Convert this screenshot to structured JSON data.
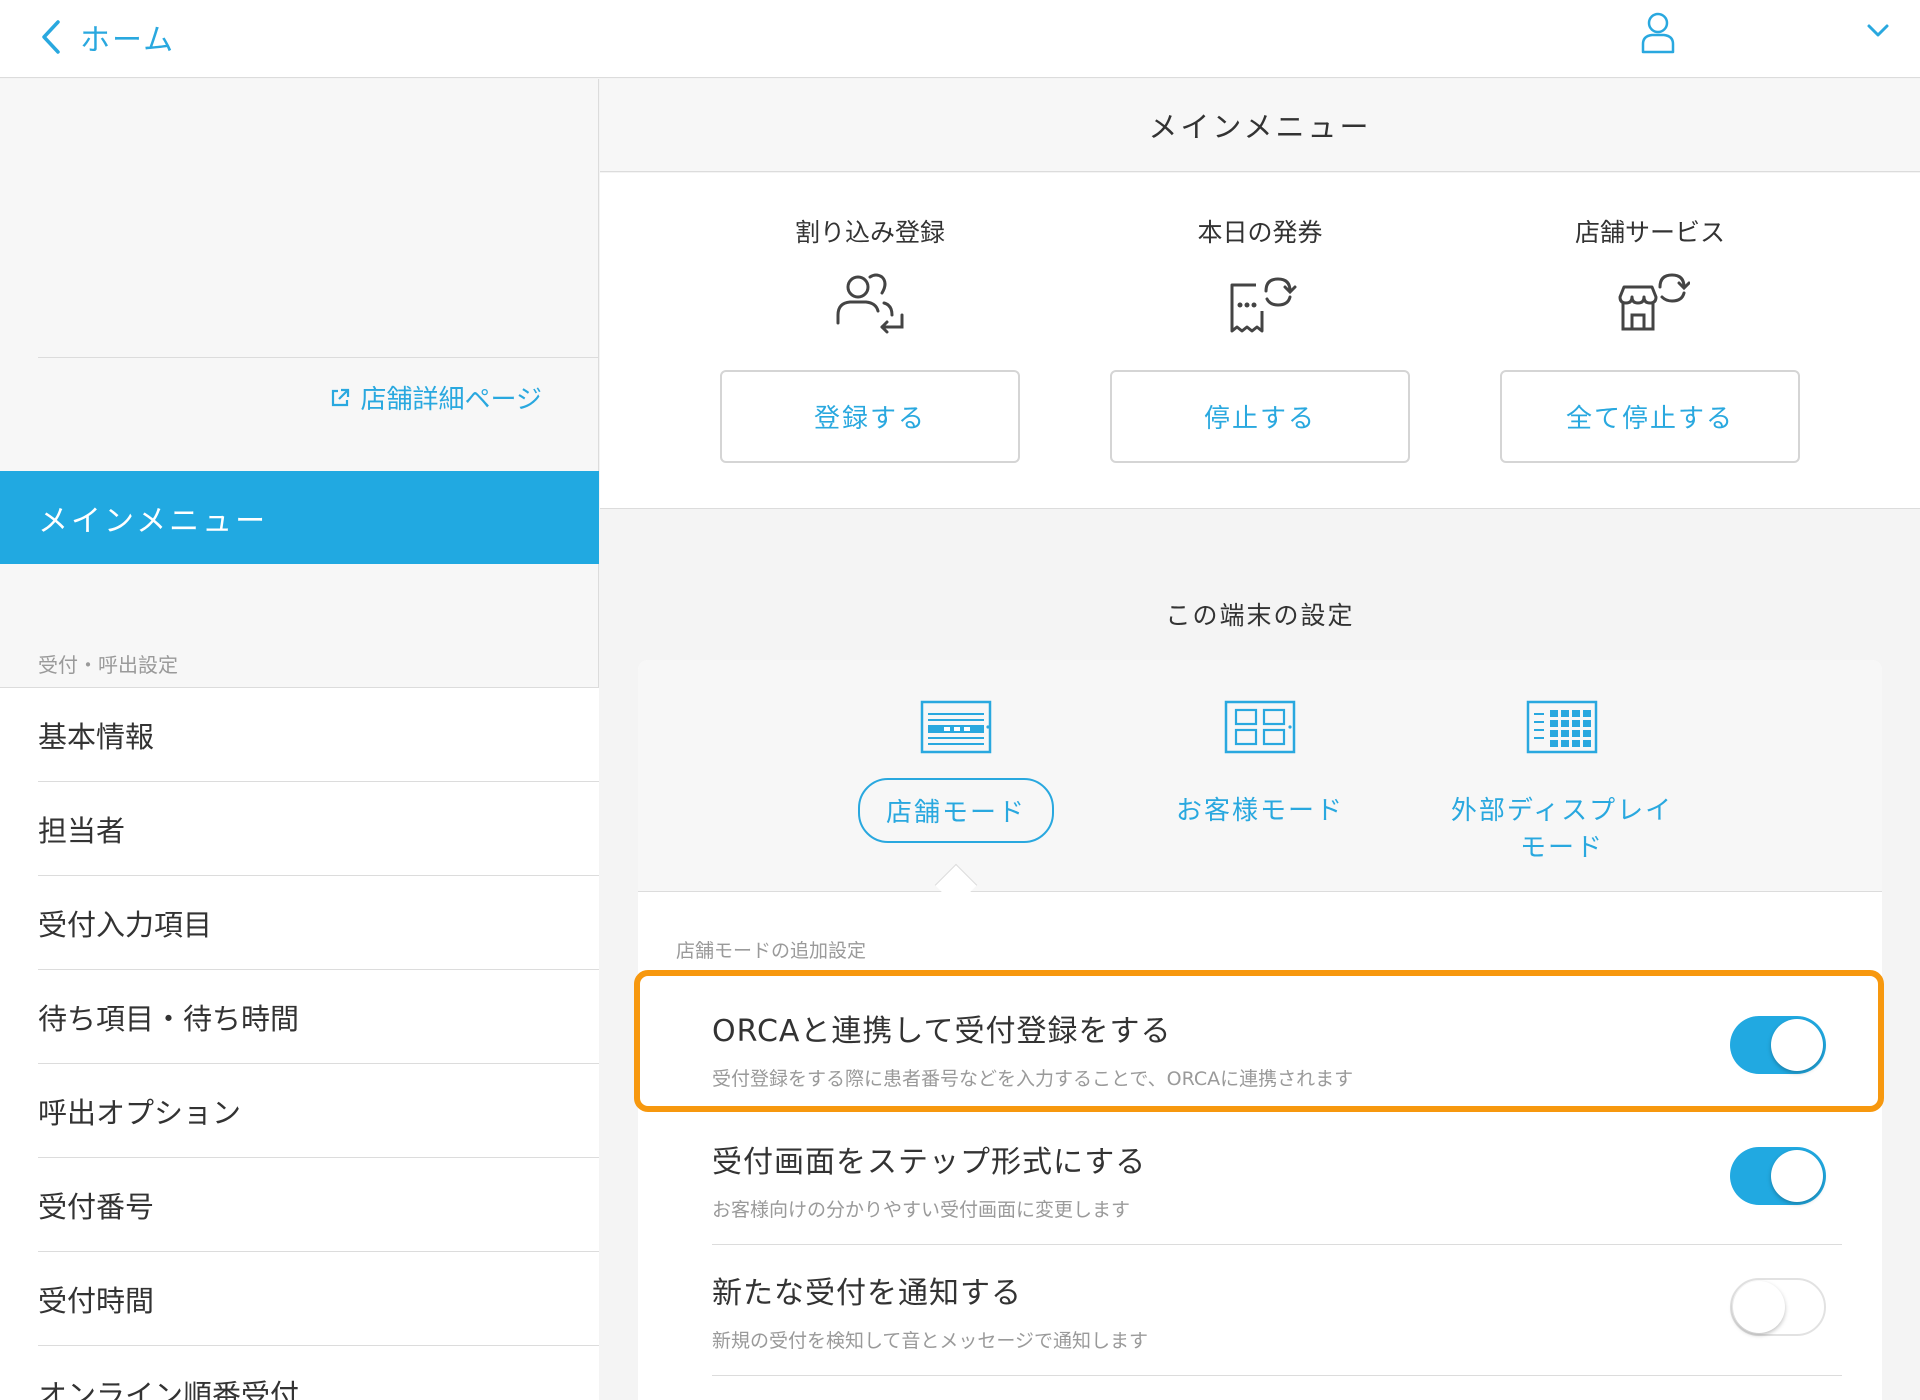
{
  "header": {
    "back_label": "ホーム",
    "icons": {
      "back": "chevron-left-icon",
      "user": "user-icon",
      "dropdown": "chevron-down-icon"
    }
  },
  "sidebar": {
    "store_link": "店舗詳細ページ",
    "active_item": "メインメニュー",
    "section_label": "受付・呼出設定",
    "items": [
      {
        "label": "基本情報"
      },
      {
        "label": "担当者"
      },
      {
        "label": "受付入力項目"
      },
      {
        "label": "待ち項目・待ち時間"
      },
      {
        "label": "呼出オプション"
      },
      {
        "label": "受付番号"
      },
      {
        "label": "受付時間"
      },
      {
        "label": "オンライン順番受付"
      }
    ]
  },
  "main": {
    "title": "メインメニュー",
    "quick_actions": [
      {
        "label": "割り込み登録",
        "button": "登録する",
        "icon": "people-swap-icon"
      },
      {
        "label": "本日の発券",
        "button": "停止する",
        "icon": "ticket-refresh-icon"
      },
      {
        "label": "店舗サービス",
        "button": "全て停止する",
        "icon": "store-refresh-icon"
      }
    ],
    "device_settings_title": "この端末の設定",
    "modes": [
      {
        "label": "店舗モード",
        "icon": "store-mode-icon",
        "selected": true
      },
      {
        "label": "お客様モード",
        "icon": "customer-mode-icon",
        "selected": false
      },
      {
        "label": "外部ディスプレイモード",
        "icon": "external-display-mode-icon",
        "selected": false
      }
    ],
    "additional_settings_label": "店舗モードの追加設定",
    "settings": [
      {
        "title": "ORCAと連携して受付登録をする",
        "description": "受付登録をする際に患者番号などを入力することで、ORCAに連携されます",
        "enabled": true,
        "highlighted": true
      },
      {
        "title": "受付画面をステップ形式にする",
        "description": "お客様向けの分かりやすい受付画面に変更します",
        "enabled": true,
        "highlighted": false
      },
      {
        "title": "新たな受付を通知する",
        "description": "新規の受付を検知して音とメッセージで通知します",
        "enabled": false,
        "highlighted": false
      }
    ]
  },
  "colors": {
    "accent": "#21a9e1",
    "link": "#29a8df",
    "highlight_border": "#f7980e",
    "sidebar_bg": "#f7f7f7",
    "divider": "#dcdcdc"
  }
}
